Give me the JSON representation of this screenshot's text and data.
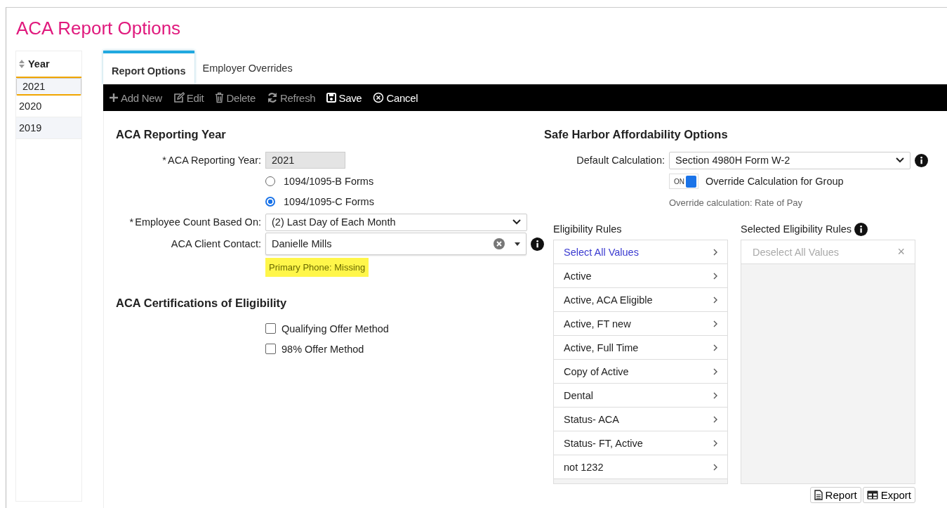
{
  "title": "ACA Report Options",
  "year_list": {
    "header": "Year",
    "items": [
      {
        "label": "2021",
        "selected": true
      },
      {
        "label": "2020",
        "selected": false
      },
      {
        "label": "2019",
        "selected": false
      }
    ]
  },
  "tabs": [
    {
      "label": "Report Options",
      "selected": true
    },
    {
      "label": "Employer Overrides",
      "selected": false
    }
  ],
  "toolbar": [
    {
      "kind": "add",
      "label": "Add New",
      "disabled": true
    },
    {
      "kind": "edit",
      "label": "Edit",
      "disabled": true
    },
    {
      "kind": "delete",
      "label": "Delete",
      "disabled": true
    },
    {
      "kind": "refresh",
      "label": "Refresh",
      "disabled": true
    },
    {
      "kind": "save",
      "label": "Save",
      "disabled": false
    },
    {
      "kind": "cancel",
      "label": "Cancel",
      "disabled": false
    }
  ],
  "reporting": {
    "heading": "ACA Reporting Year",
    "year_label": "ACA Reporting Year:",
    "required_mark": "*",
    "year_value": "2021",
    "forms": [
      {
        "label": "1094/1095-B Forms",
        "selected": false
      },
      {
        "label": "1094/1095-C Forms",
        "selected": true
      }
    ],
    "count_label": "Employee Count Based On:",
    "count_value": "(2) Last Day of Each Month",
    "contact_label": "ACA Client Contact:",
    "contact_value": "Danielle Mills",
    "warning": "Primary Phone: Missing"
  },
  "certifications": {
    "heading": "ACA Certifications of Eligibility",
    "options": [
      {
        "label": "Qualifying Offer Method",
        "checked": false
      },
      {
        "label": "98% Offer Method",
        "checked": false
      }
    ]
  },
  "safe_harbor": {
    "heading": "Safe Harbor Affordability Options",
    "calc_label": "Default Calculation:",
    "calc_value": "Section 4980H Form W-2",
    "toggle": {
      "text": "ON",
      "on": true,
      "label": "Override Calculation for Group"
    },
    "note": "Override calculation: Rate of Pay"
  },
  "rules": {
    "heading": "Eligibility Rules",
    "select_all": "Select All Values",
    "items": [
      "Active",
      "Active, ACA Eligible",
      "Active, FT new",
      "Active, Full Time",
      "Copy of Active",
      "Dental",
      "Status- ACA",
      "Status- FT, Active",
      "not 1232"
    ]
  },
  "selected_rules": {
    "heading": "Selected Eligibility Rules",
    "deselect_all": "Deselect All Values",
    "close": "×"
  },
  "actions": [
    {
      "kind": "report",
      "label": "Report"
    },
    {
      "kind": "export",
      "label": "Export"
    }
  ]
}
